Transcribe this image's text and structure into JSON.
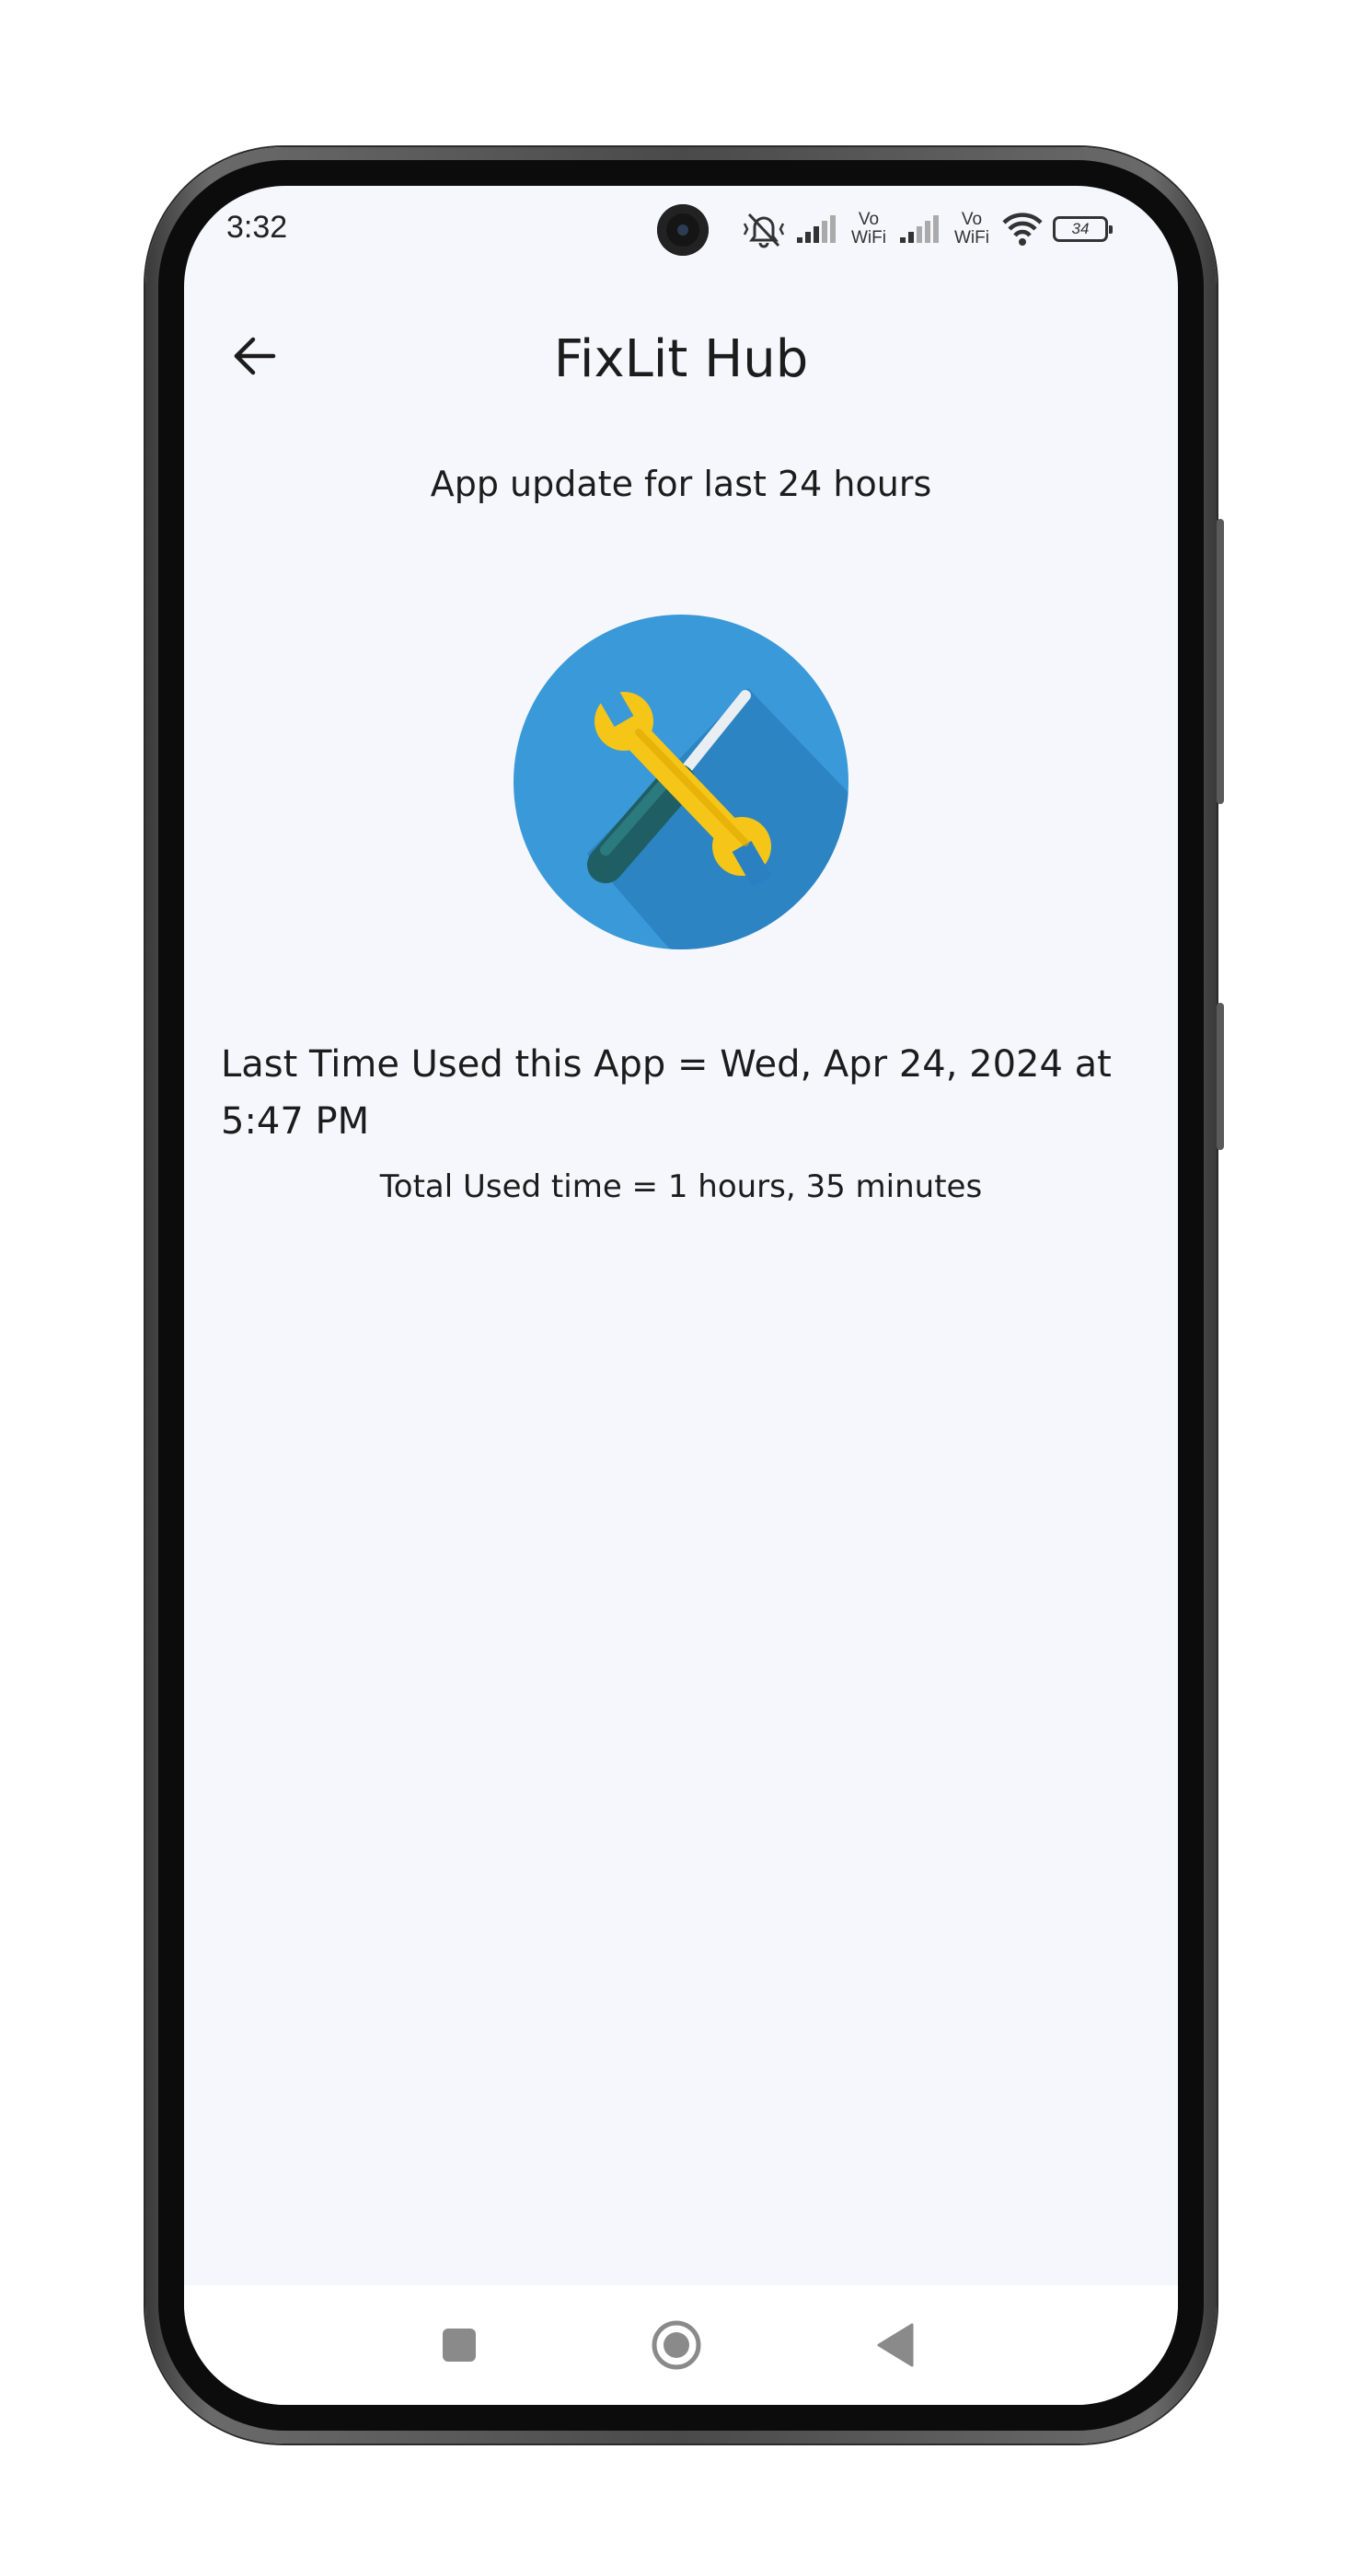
{
  "status_bar": {
    "time": "3:32",
    "vowifi_1": "Vo WiFi",
    "vowifi_2": "Vo WiFi",
    "battery": "34",
    "icons": [
      "mute-vibrate-icon",
      "signal-icon",
      "signal-icon",
      "wifi-icon",
      "battery-icon"
    ]
  },
  "app_bar": {
    "title": "FixLit Hub",
    "back_icon": "arrow-left-icon"
  },
  "content": {
    "subtitle": "App update for last 24 hours",
    "app_icon": "tools-wrench-screwdriver-icon",
    "last_used": "Last Time Used this App = Wed, Apr 24, 2024 at 5:47 PM",
    "total_used": "Total Used time = 1 hours, 35 minutes"
  },
  "nav_bar": {
    "icons": [
      "recents-square-icon",
      "home-circle-icon",
      "back-triangle-icon"
    ]
  },
  "colors": {
    "screen_bg": "#f6f7fd",
    "logo_blue": "#3a99d8",
    "logo_yellow": "#f5c518",
    "nav_gray": "#8a8a8a"
  }
}
